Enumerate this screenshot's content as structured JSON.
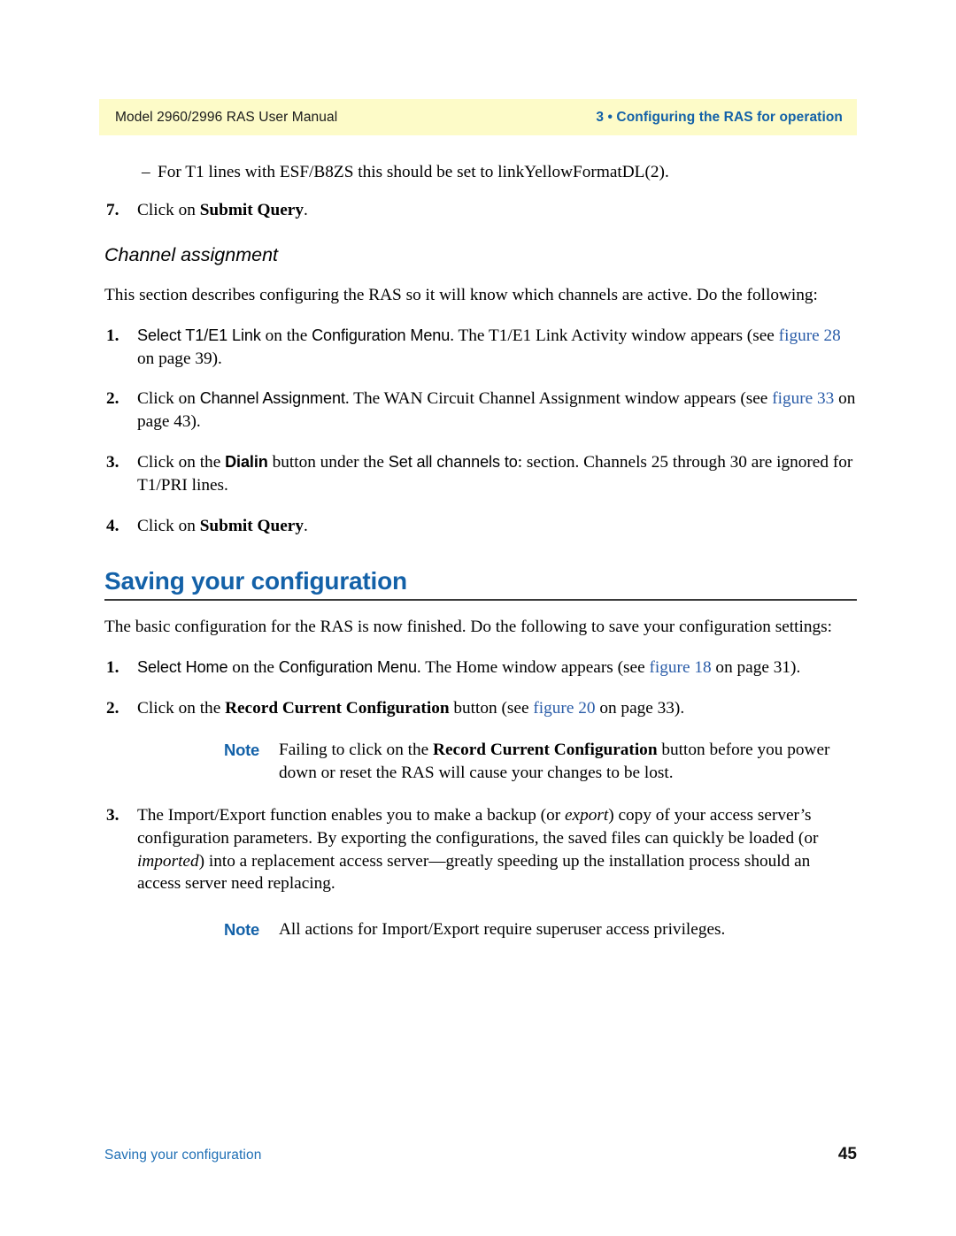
{
  "header": {
    "left_title": "Model 2960/2996 RAS User Manual",
    "right_title": "3 • Configuring the RAS for operation",
    "band_color": "#fdfbc8",
    "accent_color": "#1361a8"
  },
  "body": {
    "dash_bullet": {
      "marker": "–",
      "text": "For T1 lines with ESF/B8ZS this should be set to linkYellowFormatDL(2)."
    },
    "step7": {
      "number": "7.",
      "prefix": "Click on ",
      "bold": "Submit Query",
      "suffix": "."
    },
    "channel_assignment": {
      "heading": "Channel assignment",
      "intro": "This section describes configuring the RAS so it will know which channels are active. Do the following:",
      "steps": [
        {
          "number": "1.",
          "seg_a_sans": "Select T1/E1 Link",
          "seg_b": " on the ",
          "seg_c_sans": "Configuration Menu",
          "seg_d": ". The T1/E1 Link Activity window appears (see ",
          "xref": "figure 28",
          "seg_e": " on page 39)."
        },
        {
          "number": "2.",
          "seg_a": "Click on ",
          "seg_b_sans": "Channel Assignment",
          "seg_c": ". The WAN Circuit Channel Assignment window appears (see ",
          "xref": "figure 33",
          "seg_d": " on page 43)."
        },
        {
          "number": "3.",
          "seg_a": "Click on the ",
          "seg_b_sans_bold": "Dialin",
          "seg_c": " button under the ",
          "seg_d_sans": "Set all channels to",
          "seg_e": ": section. Channels 25 through 30 are ignored for T1/PRI lines."
        },
        {
          "number": "4.",
          "seg_a": "Click on ",
          "seg_b_bold": "Submit Query",
          "seg_c": "."
        }
      ]
    },
    "saving": {
      "heading": "Saving your configuration",
      "intro": "The basic configuration for the RAS is now finished. Do the following to save your configuration settings:",
      "steps": [
        {
          "number": "1.",
          "seg_a_sans": "Select Home",
          "seg_b": " on the ",
          "seg_c_sans": "Configuration Menu",
          "seg_d": ". The Home window appears (see ",
          "xref": "figure 18",
          "seg_e": " on page 31)."
        },
        {
          "number": "2.",
          "seg_a": "Click on the ",
          "seg_b_bold": "Record Current Configuration",
          "seg_c": " button (see ",
          "xref": "figure 20",
          "seg_d": " on page 33)."
        },
        {
          "number": "3.",
          "seg_a": "The Import/Export function enables you to make a backup (or ",
          "seg_b_ital": "export",
          "seg_c": ") copy of your access server’s configuration parameters. By exporting the configurations, the saved files can quickly be loaded (or ",
          "seg_d_ital": "imported",
          "seg_e": ") into a replacement access server—greatly speeding up the installation process should an access server need replacing."
        }
      ],
      "note1": {
        "label": "Note",
        "seg_a": "Failing to click on the ",
        "seg_b_bold": "Record Current Configuration",
        "seg_c": " button before you power down or reset the RAS will cause your changes to be lost."
      },
      "note2": {
        "label": "Note",
        "text": "All actions for Import/Export require superuser access privileges."
      }
    }
  },
  "footer": {
    "left": "Saving your configuration",
    "page_number": "45"
  }
}
